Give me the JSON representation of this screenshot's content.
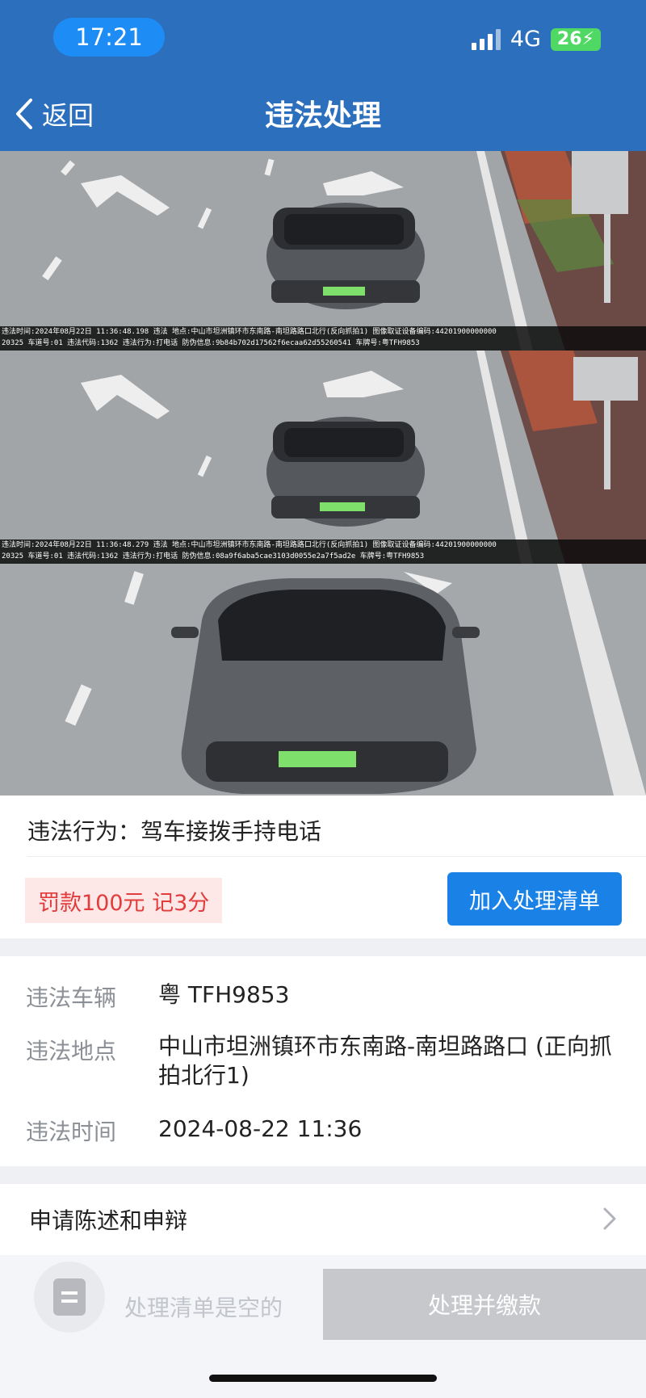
{
  "status_bar": {
    "time": "17:21",
    "network": "4G",
    "battery": "26",
    "icons": [
      "signal-icon",
      "battery-charging-icon"
    ]
  },
  "header": {
    "back_label": "返回",
    "title": "违法处理"
  },
  "photos": {
    "plate": "粤T·FH9853",
    "captions": [
      {
        "line1": "违法时间:2024年08月22日 11:36:48.198 违法 地点:中山市坦洲镇环市东南路-南坦路路口北行(反向抓拍1) 图像取证设备编码:44201900000000",
        "line2": "20325 车道号:01 违法代码:1362 违法行为:打电话 防伪信息:9b84b702d17562f6ecaa62d55260541 车牌号:粤TFH9853"
      },
      {
        "line1": "违法时间:2024年08月22日 11:36:48.279 违法 地点:中山市坦洲镇环市东南路-南坦路路口北行(反向抓拍1) 图像取证设备编码:44201900000000",
        "line2": "20325 车道号:01 违法代码:1362 违法行为:打电话 防伪信息:08a9f6aba5cae3103d0055e2a7f5ad2e 车牌号:粤TFH9853"
      }
    ]
  },
  "violation": {
    "behavior": "违法行为：驾车接拨手持电话",
    "penalty": "罚款100元  记3分",
    "add_button": "加入处理清单"
  },
  "details": {
    "vehicle_label": "违法车辆",
    "vehicle_value": "粤 TFH9853",
    "location_label": "违法地点",
    "location_value": "中山市坦洲镇环市东南路-南坦路路口 (正向抓拍北行1)",
    "time_label": "违法时间",
    "time_value": "2024-08-22 11:36"
  },
  "appeal": {
    "label": "申请陈述和申辩"
  },
  "bottom_bar": {
    "empty_text": "处理清单是空的",
    "pay_button": "处理并缴款"
  },
  "colors": {
    "header": "#2b6fbd",
    "primary_button": "#1a82e6",
    "penalty_bg": "#fde7e7",
    "penalty_text": "#e23c3c"
  }
}
